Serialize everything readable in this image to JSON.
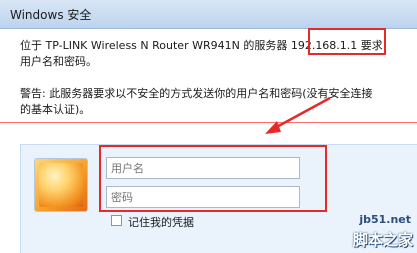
{
  "window": {
    "title": "Windows 安全"
  },
  "message": {
    "line1": "位于 TP-LINK Wireless N Router WR941N 的服务器 192.168.1.1 要求",
    "line2": "用户名和密码。",
    "line3": "警告: 此服务器要求以不安全的方式发送你的用户名和密码(没有安全连接",
    "line4": "的基本认证)。"
  },
  "credentials": {
    "username_placeholder": "用户名",
    "password_placeholder": "密码",
    "remember_label": "记住我的凭据"
  },
  "watermark": {
    "site": "jb51.net",
    "brand": "脚本之家"
  },
  "colors": {
    "highlight": "#e52a2a",
    "title_bar": "#bcd3ee",
    "panel": "#eaf3fc"
  }
}
